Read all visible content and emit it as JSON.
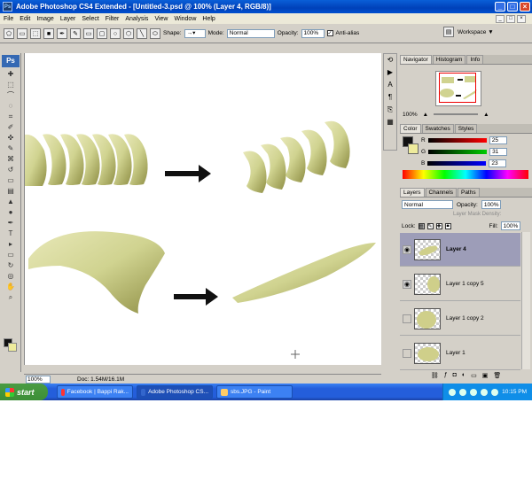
{
  "window": {
    "title": "Adobe Photoshop CS4 Extended - [Untitled-3.psd @ 100% (Layer 4, RGB/8)]",
    "app_icon": "Ps",
    "controls": [
      "minimize-icon",
      "maximize-icon",
      "close-icon"
    ]
  },
  "menu": {
    "items": [
      "File",
      "Edit",
      "Image",
      "Layer",
      "Select",
      "Filter",
      "Analysis",
      "View",
      "Window",
      "Help"
    ]
  },
  "options": {
    "shape_label": "Shape:",
    "mode_label": "Mode:",
    "mode_value": "Normal",
    "opacity_label": "Opacity:",
    "opacity_value": "100%",
    "antialias_label": "Anti-alias",
    "workspace_label": "Workspace ▼"
  },
  "toolbox": {
    "logo": "Ps",
    "tools": [
      "move-icon",
      "marquee-icon",
      "lasso-icon",
      "quick-select-icon",
      "crop-icon",
      "eyedropper-icon",
      "healing-icon",
      "brush-icon",
      "stamp-icon",
      "history-brush-icon",
      "eraser-icon",
      "gradient-icon",
      "blur-icon",
      "dodge-icon",
      "pen-icon",
      "type-icon",
      "path-select-icon",
      "shape-icon",
      "3d-rotate-icon",
      "3d-orbit-icon",
      "hand-icon",
      "zoom-icon"
    ],
    "tool_glyphs": [
      "✚",
      "⬚",
      "⌒",
      "◌",
      "⌗",
      "✐",
      "✜",
      "✎",
      "⌘",
      "↺",
      "▭",
      "▤",
      "▲",
      "●",
      "✒",
      "T",
      "▸",
      "▭",
      "↻",
      "◎",
      "✋",
      "⌕"
    ],
    "foreground": "#111111",
    "background": "#eeeb9c"
  },
  "status": {
    "zoom": "100%",
    "doc": "Doc: 1.54M/16.1M"
  },
  "navigator": {
    "tabs": [
      "Navigator",
      "Histogram",
      "Info"
    ],
    "zoom": "100%"
  },
  "color_panel": {
    "tabs": [
      "Color",
      "Swatches",
      "Styles"
    ],
    "r_label": "R",
    "g_label": "G",
    "b_label": "B",
    "r": "25",
    "g": "31",
    "b": "23"
  },
  "layers": {
    "tabs": [
      "Layers",
      "Channels",
      "Paths"
    ],
    "blend": "Normal",
    "opacity_label": "Opacity:",
    "opacity": "100%",
    "density_label": "Layer Mask Density:",
    "lock_label": "Lock:",
    "fill_label": "Fill:",
    "fill": "100%",
    "items": [
      {
        "name": "Layer 4",
        "visible": true,
        "selected": true
      },
      {
        "name": "Layer 1 copy 5",
        "visible": true,
        "selected": false
      },
      {
        "name": "Layer 1 copy 2",
        "visible": false,
        "selected": false
      },
      {
        "name": "Layer 1",
        "visible": false,
        "selected": false
      }
    ]
  },
  "taskbar": {
    "start": "start",
    "tasks": [
      "Facebook | Bappi Rak...",
      "Adobe Photoshop CS...",
      "sbs.JPG - Paint"
    ],
    "clock": "10:15 PM"
  },
  "colors": {
    "blade": "#d4d79a",
    "blade_dark": "#8f8f45",
    "arrow": "#111111",
    "selected_layer": "#9d9db8"
  }
}
